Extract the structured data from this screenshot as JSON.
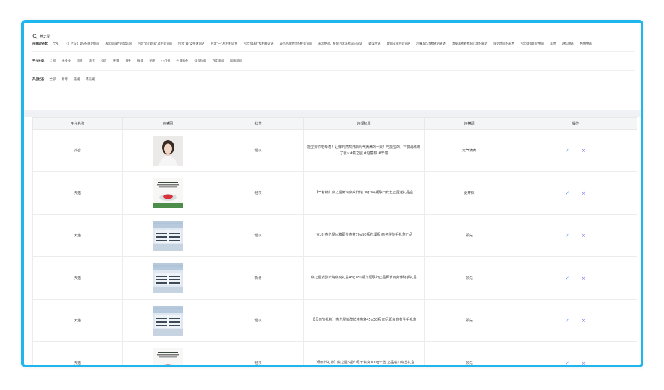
{
  "search": {
    "query": "燕之屋"
  },
  "filters": {
    "violation_category": {
      "label": "违规词分类：",
      "options": [
        "全部",
        "《广告法》第9条规定情形",
        "表示权威性的禁忌词",
        "包含\"首/第/家\"及相关词语",
        "包含\"最\"及相关词语",
        "包含\"一\"及相关词语",
        "包含\"级/极\"及相关词语",
        "表示品牌地位的相关词语",
        "表示绝对、极限且无法考证的词语",
        "疑误用语",
        "虚假内容相关词语",
        "涉嫌欺诈消费者的表述",
        "激发消费者抢购心理的表述",
        "限定时间的表述",
        "包含疑似医疗用语",
        "其他",
        "迷信用语",
        "色情用语"
      ]
    },
    "platform": {
      "label": "平台分类：",
      "options": [
        "全部",
        "拼多多",
        "京东",
        "淘宝",
        "抖音",
        "天猫",
        "快手",
        "微博",
        "贴吧",
        "小红书",
        "今日头条",
        "抖音热榜",
        "百度新闻",
        "凤凰新闻"
      ]
    },
    "status": {
      "label": "产品状态：",
      "options": [
        "全部",
        "新增",
        "违规",
        "不违规"
      ]
    }
  },
  "table": {
    "headers": [
      "平台名称",
      "违禁图",
      "状态",
      "违规标题",
      "违禁词",
      "操作"
    ],
    "rows": [
      {
        "platform": "抖音",
        "status": "侵权",
        "title": "能宝畀你吃辛着！让鲜炖燕窝开启元气满满的一天！吃能宝的，不要再瞧瞧了哦~#燕之屋 #赵丽颖 #辛着",
        "word": "元气满满",
        "image": "person"
      },
      {
        "platform": "天猫",
        "status": "侵权",
        "title": "【辛着编】燕之屋鲜炖燕窝鲜炖70g*84瓶孕妇女士正品送礼品盒",
        "word": "更环保",
        "image": "poster"
      },
      {
        "platform": "天猫",
        "status": "侵权",
        "title": "[618]燕之屋冰糖即食燕窝70g90瓶花溪瓶 商务伴随手礼盒正品",
        "word": "领先",
        "image": "hall"
      },
      {
        "platform": "天猫",
        "status": "新增",
        "title": "燕之屋浓醇鲜炖燕窝礼盒45g180瓶印尼孕妇正品即食商务伴随手礼品",
        "word": "领先",
        "image": "hall"
      },
      {
        "platform": "天猫",
        "status": "侵权",
        "title": "【母亲节礼物】燕之屋浓醇鲜炖燕窝45g30瓶 印尼即食商务伴手礼盒",
        "word": "领先",
        "image": "hall"
      },
      {
        "platform": "天猫",
        "status": "侵权",
        "title": "【母亲节礼物】燕之屋6星印尼干燕窝100g干盏 正品进口燕盏礼盒",
        "word": "领先",
        "image": "poster2"
      }
    ]
  },
  "colors": {
    "frame": "#1fb6ee",
    "confirm": "#3d8bfd",
    "reject": "#5a5ae6"
  },
  "icons": {
    "search": "search-icon",
    "confirm": "check-icon",
    "reject": "close-icon"
  },
  "glyphs": {
    "check": "✓",
    "cross": "×"
  }
}
